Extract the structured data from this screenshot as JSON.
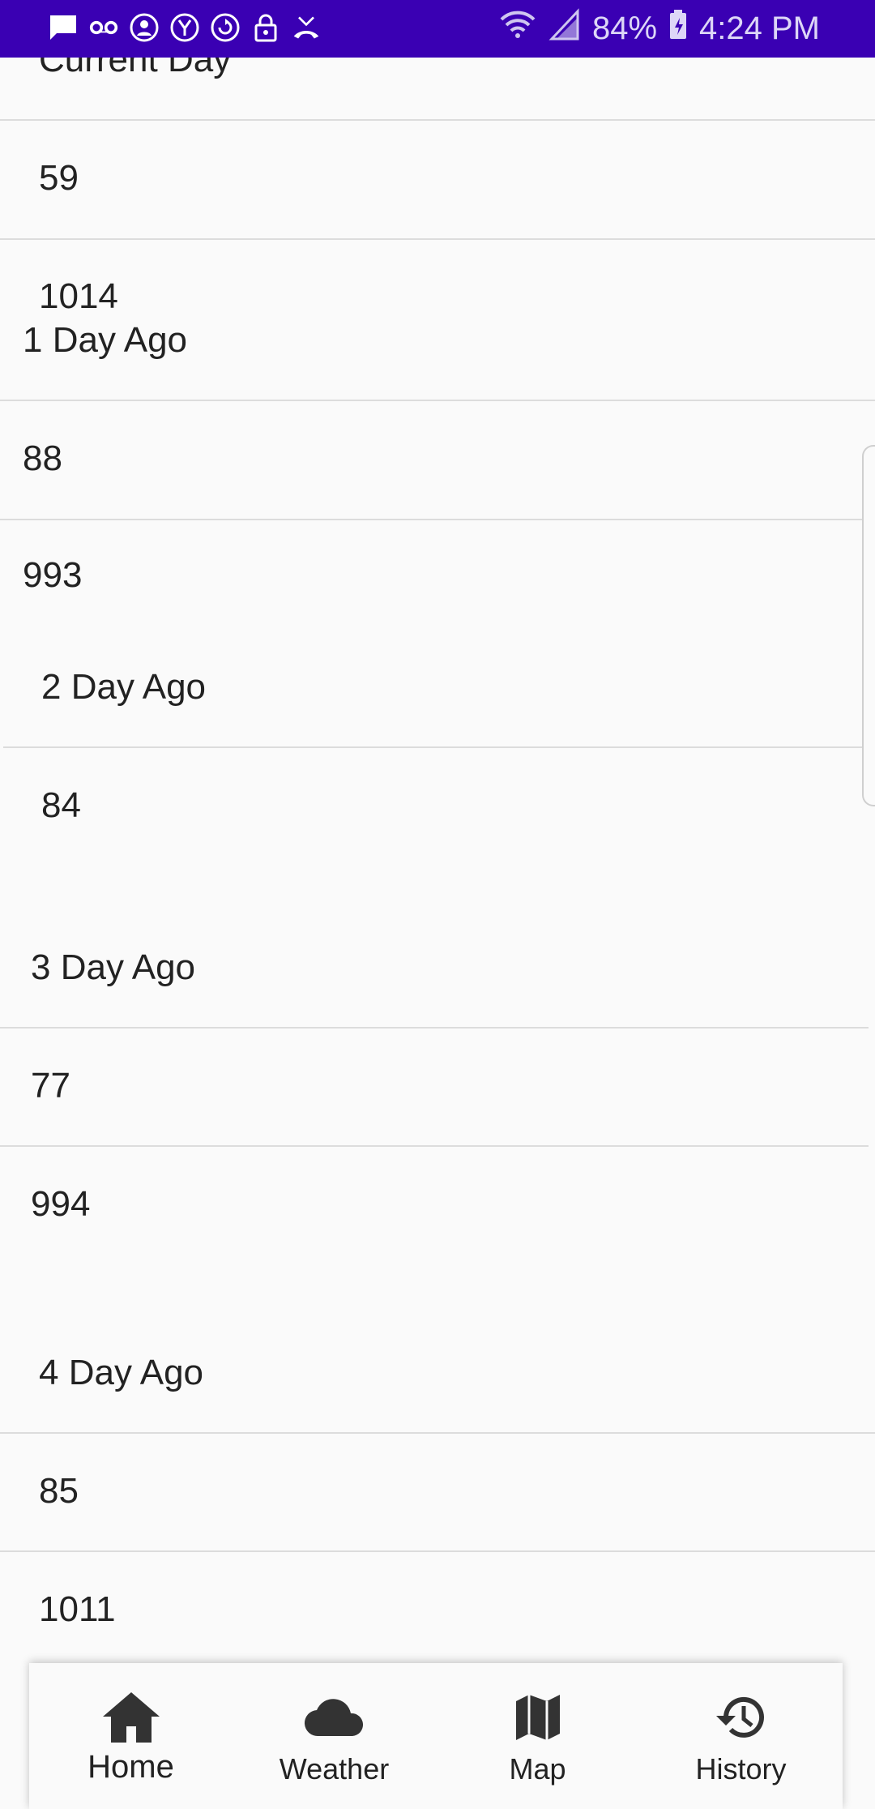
{
  "status_bar": {
    "notification_icons": [
      "message-icon",
      "voicemail-icon",
      "account-icon",
      "yahoo-icon",
      "sync-icon",
      "lock-icon",
      "missed-call-icon"
    ],
    "battery_percent": "84%",
    "time": "4:24 PM"
  },
  "records": [
    {
      "label": "Current Day",
      "values": [
        "59",
        "1014"
      ]
    },
    {
      "label": "1 Day Ago",
      "values": [
        "88",
        "993"
      ]
    },
    {
      "label": "2 Day Ago",
      "values": [
        "84"
      ]
    },
    {
      "label": "3 Day Ago",
      "values": [
        "77",
        "994"
      ]
    },
    {
      "label": "4 Day Ago",
      "values": [
        "85",
        "1011"
      ]
    }
  ],
  "bottom_nav": {
    "items": [
      {
        "label": "Home",
        "icon": "home-icon",
        "active": true
      },
      {
        "label": "Weather",
        "icon": "cloud-icon"
      },
      {
        "label": "Map",
        "icon": "map-icon"
      },
      {
        "label": "History",
        "icon": "history-icon"
      }
    ]
  },
  "colors": {
    "status_bar": "#3a00b3",
    "background": "#fafafa",
    "divider": "#dcdcdc"
  }
}
